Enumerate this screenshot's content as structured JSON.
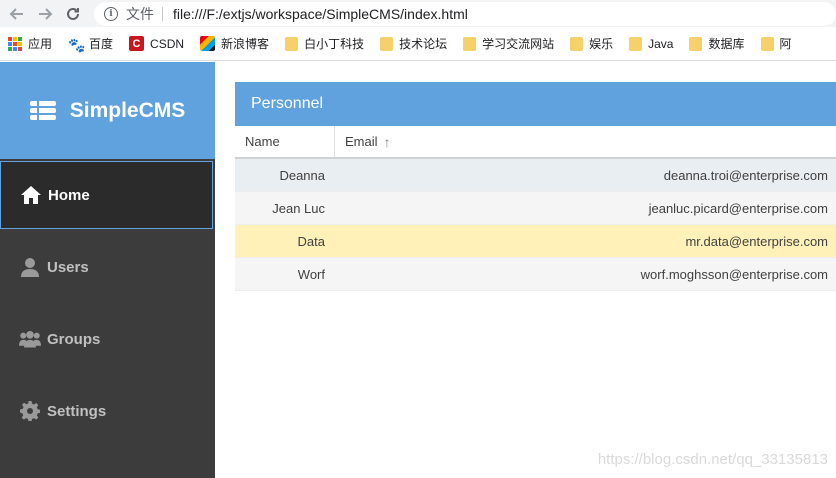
{
  "browser": {
    "url_label": "文件",
    "url": "file:///F:/extjs/workspace/SimpleCMS/index.html"
  },
  "bookmarks": [
    {
      "label": "应用",
      "icon": "apps-icon"
    },
    {
      "label": "百度",
      "icon": "baidu-icon"
    },
    {
      "label": "CSDN",
      "icon": "csdn-icon"
    },
    {
      "label": "新浪博客",
      "icon": "sina-icon"
    },
    {
      "label": "白小丁科技",
      "icon": "folder-icon"
    },
    {
      "label": "技术论坛",
      "icon": "folder-icon"
    },
    {
      "label": "学习交流网站",
      "icon": "folder-icon"
    },
    {
      "label": "娱乐",
      "icon": "folder-icon"
    },
    {
      "label": "Java",
      "icon": "folder-icon"
    },
    {
      "label": "数据库",
      "icon": "folder-icon"
    },
    {
      "label": "阿",
      "icon": "folder-icon"
    }
  ],
  "app": {
    "title": "SimpleCMS",
    "menu": [
      {
        "label": "Home",
        "icon": "home-icon",
        "active": true
      },
      {
        "label": "Users",
        "icon": "user-icon",
        "active": false
      },
      {
        "label": "Groups",
        "icon": "users-icon",
        "active": false
      },
      {
        "label": "Settings",
        "icon": "gear-icon",
        "active": false
      }
    ]
  },
  "panel": {
    "title": "Personnel",
    "columns": {
      "name": "Name",
      "email": "Email"
    },
    "sort_indicator": "↑",
    "rows": [
      {
        "name": "Deanna",
        "email": "deanna.troi@enterprise.com"
      },
      {
        "name": "Jean Luc",
        "email": "jeanluc.picard@enterprise.com"
      },
      {
        "name": "Data",
        "email": "mr.data@enterprise.com"
      },
      {
        "name": "Worf",
        "email": "worf.moghsson@enterprise.com"
      }
    ]
  },
  "watermark": "https://blog.csdn.net/qq_33135813",
  "colors": {
    "accent": "#5fa2dd",
    "sidebar": "#3c3c3c",
    "row_hover": "#fff1b8"
  }
}
